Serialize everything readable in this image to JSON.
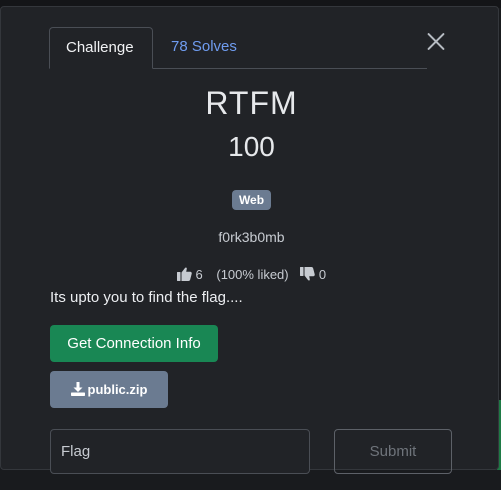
{
  "tabs": [
    {
      "label": "Challenge",
      "active": true
    },
    {
      "label": "78 Solves",
      "active": false
    }
  ],
  "challenge": {
    "name": "RTFM",
    "points": "100",
    "category": "Web",
    "author": "f0rk3b0mb",
    "description": "Its upto you to find the flag...."
  },
  "ratings": {
    "likes": "6",
    "liked_percent": "(100% liked)",
    "dislikes": "0"
  },
  "buttons": {
    "connection_label": "Get Connection Info",
    "file_label": "public.zip",
    "submit_label": "Submit"
  },
  "flag_input": {
    "placeholder": "Flag",
    "value": ""
  },
  "icons": {
    "close": "close-icon",
    "like": "thumbs-up-icon",
    "dislike": "thumbs-down-icon",
    "download": "download-icon"
  },
  "colors": {
    "modal_bg": "#212327",
    "accent_link": "#6f9cf0",
    "success": "#198754",
    "secondary": "#6b7b91"
  }
}
